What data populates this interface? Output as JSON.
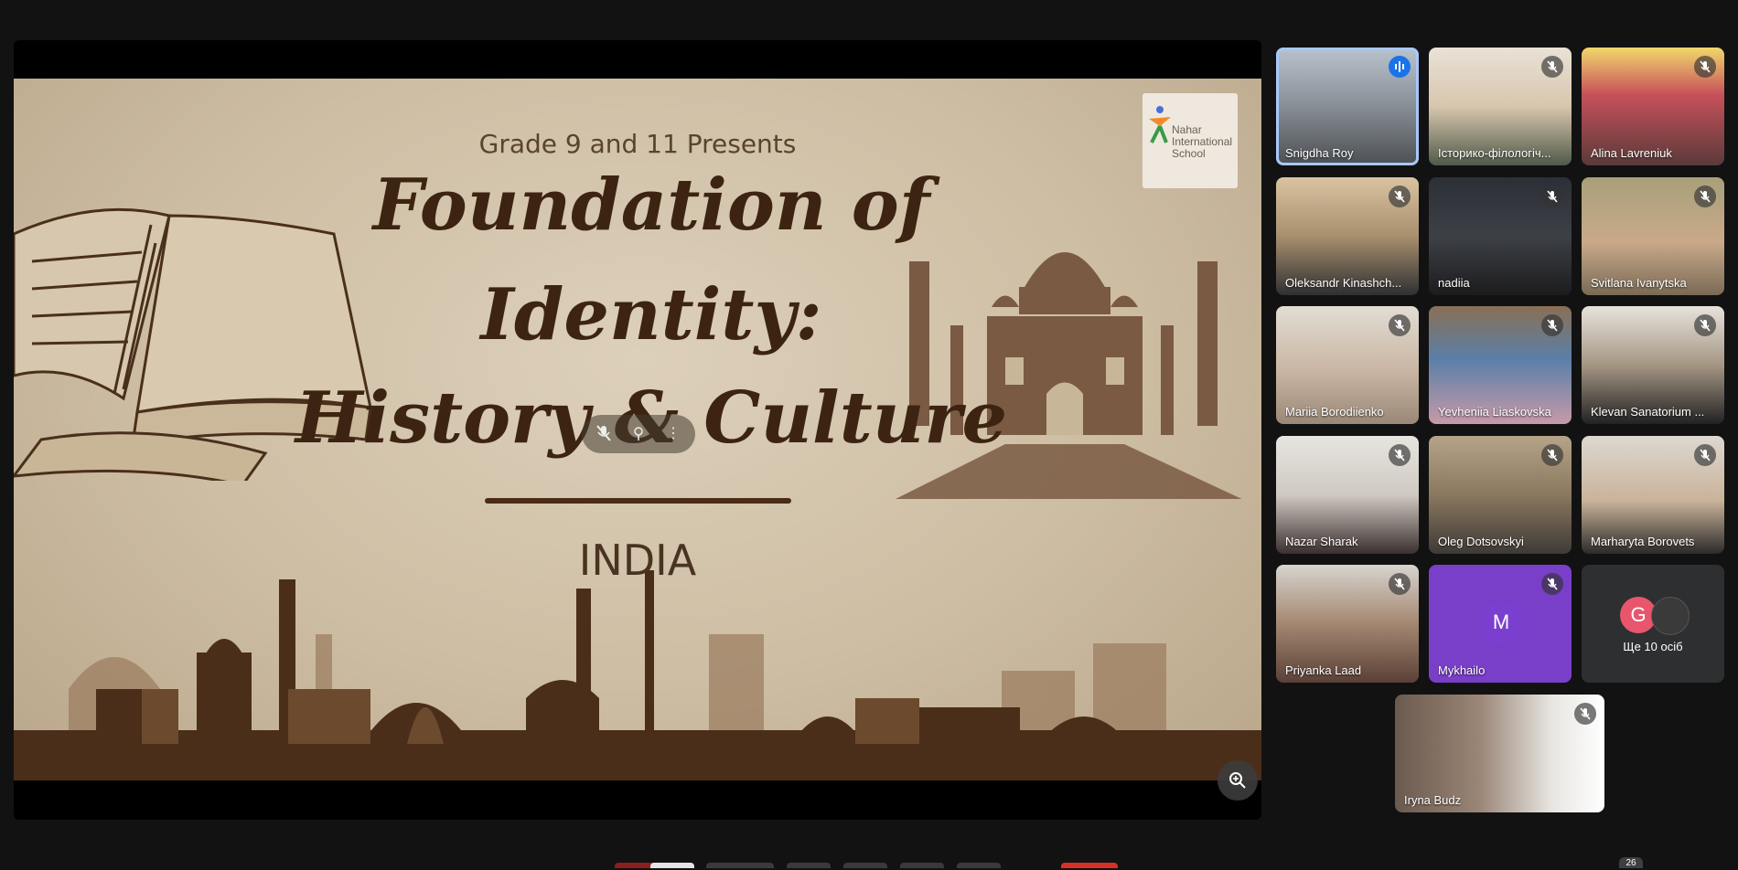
{
  "slide": {
    "subtitle": "Grade 9 and 11 Presents",
    "title_line1": "Foundation of",
    "title_line2": "Identity:",
    "title_line3": "History & Culture",
    "country": "INDIA",
    "logo_text": "Nahar International School"
  },
  "participants": [
    {
      "name": "Snigdha Roy",
      "state": "speaking"
    },
    {
      "name": "Історико-філологіч...",
      "state": "muted"
    },
    {
      "name": "Alina Lavreniuk",
      "state": "muted"
    },
    {
      "name": "Oleksandr Kinashch...",
      "state": "muted"
    },
    {
      "name": "nadiia",
      "state": "muted"
    },
    {
      "name": "Svitlana Ivanytska",
      "state": "muted"
    },
    {
      "name": "Mariia Borodiienko",
      "state": "muted"
    },
    {
      "name": "Yevheniia Liaskovska",
      "state": "muted"
    },
    {
      "name": "Klevan Sanatorium ...",
      "state": "muted"
    },
    {
      "name": "Nazar Sharak",
      "state": "muted"
    },
    {
      "name": "Oleg Dotsovskyi",
      "state": "muted"
    },
    {
      "name": "Marharyta Borovets",
      "state": "muted"
    },
    {
      "name": "Priyanka Laad",
      "state": "muted"
    },
    {
      "name": "Mykhailo",
      "state": "muted",
      "avatar_letter": "M"
    },
    {
      "name": "Iryna Budz",
      "state": "muted"
    }
  ],
  "more_tile": {
    "avatar_letter": "G",
    "label": "Ще 10 осіб"
  },
  "participant_count": "26",
  "colors": {
    "background": "#121212",
    "active_outline": "#a8c7fa",
    "speaking": "#1a73e8",
    "avatar_purple": "#7b3fd0"
  }
}
